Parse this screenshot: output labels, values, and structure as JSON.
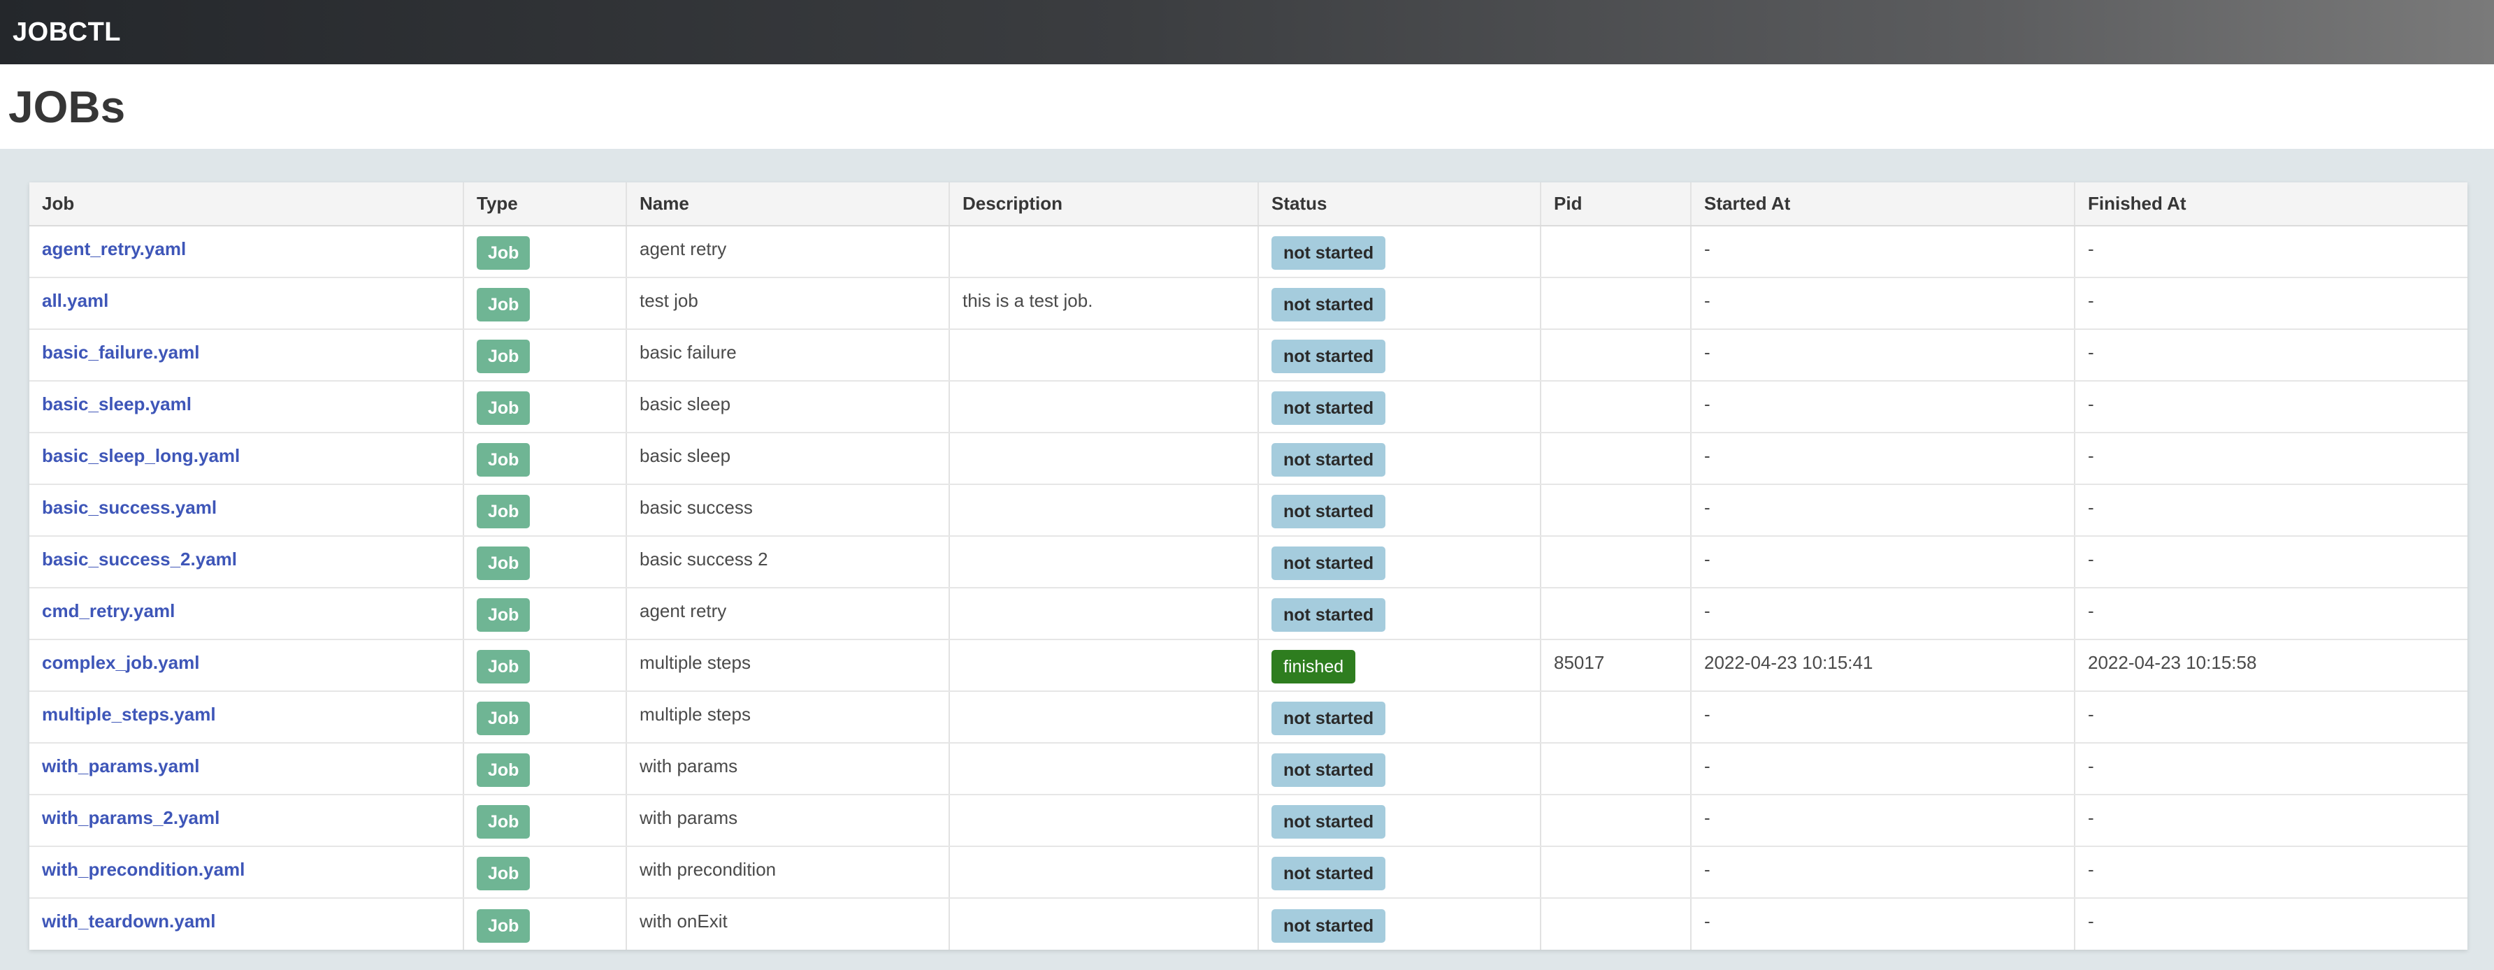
{
  "app": {
    "brand": "JOBCTL"
  },
  "page": {
    "title": "JOBs"
  },
  "table": {
    "columns": [
      "Job",
      "Type",
      "Name",
      "Description",
      "Status",
      "Pid",
      "Started At",
      "Finished At"
    ],
    "rows": [
      {
        "job": "agent_retry.yaml",
        "type": "Job",
        "name": "agent retry",
        "description": "",
        "status": "not started",
        "pid": "",
        "started_at": "-",
        "finished_at": "-"
      },
      {
        "job": "all.yaml",
        "type": "Job",
        "name": "test job",
        "description": "this is a test job.",
        "status": "not started",
        "pid": "",
        "started_at": "-",
        "finished_at": "-"
      },
      {
        "job": "basic_failure.yaml",
        "type": "Job",
        "name": "basic failure",
        "description": "",
        "status": "not started",
        "pid": "",
        "started_at": "-",
        "finished_at": "-"
      },
      {
        "job": "basic_sleep.yaml",
        "type": "Job",
        "name": "basic sleep",
        "description": "",
        "status": "not started",
        "pid": "",
        "started_at": "-",
        "finished_at": "-"
      },
      {
        "job": "basic_sleep_long.yaml",
        "type": "Job",
        "name": "basic sleep",
        "description": "",
        "status": "not started",
        "pid": "",
        "started_at": "-",
        "finished_at": "-"
      },
      {
        "job": "basic_success.yaml",
        "type": "Job",
        "name": "basic success",
        "description": "",
        "status": "not started",
        "pid": "",
        "started_at": "-",
        "finished_at": "-"
      },
      {
        "job": "basic_success_2.yaml",
        "type": "Job",
        "name": "basic success 2",
        "description": "",
        "status": "not started",
        "pid": "",
        "started_at": "-",
        "finished_at": "-"
      },
      {
        "job": "cmd_retry.yaml",
        "type": "Job",
        "name": "agent retry",
        "description": "",
        "status": "not started",
        "pid": "",
        "started_at": "-",
        "finished_at": "-"
      },
      {
        "job": "complex_job.yaml",
        "type": "Job",
        "name": "multiple steps",
        "description": "",
        "status": "finished",
        "pid": "85017",
        "started_at": "2022-04-23 10:15:41",
        "finished_at": "2022-04-23 10:15:58"
      },
      {
        "job": "multiple_steps.yaml",
        "type": "Job",
        "name": "multiple steps",
        "description": "",
        "status": "not started",
        "pid": "",
        "started_at": "-",
        "finished_at": "-"
      },
      {
        "job": "with_params.yaml",
        "type": "Job",
        "name": "with params",
        "description": "",
        "status": "not started",
        "pid": "",
        "started_at": "-",
        "finished_at": "-"
      },
      {
        "job": "with_params_2.yaml",
        "type": "Job",
        "name": "with params",
        "description": "",
        "status": "not started",
        "pid": "",
        "started_at": "-",
        "finished_at": "-"
      },
      {
        "job": "with_precondition.yaml",
        "type": "Job",
        "name": "with precondition",
        "description": "",
        "status": "not started",
        "pid": "",
        "started_at": "-",
        "finished_at": "-"
      },
      {
        "job": "with_teardown.yaml",
        "type": "Job",
        "name": "with onExit",
        "description": "",
        "status": "not started",
        "pid": "",
        "started_at": "-",
        "finished_at": "-"
      }
    ]
  },
  "colors": {
    "navbar_start": "#24272b",
    "link": "#3e56b8",
    "type_tag": "#6fb594",
    "status_not_started": "#a5ccdd",
    "status_finished": "#2e7d1f",
    "page_background": "#dfe6e9"
  }
}
